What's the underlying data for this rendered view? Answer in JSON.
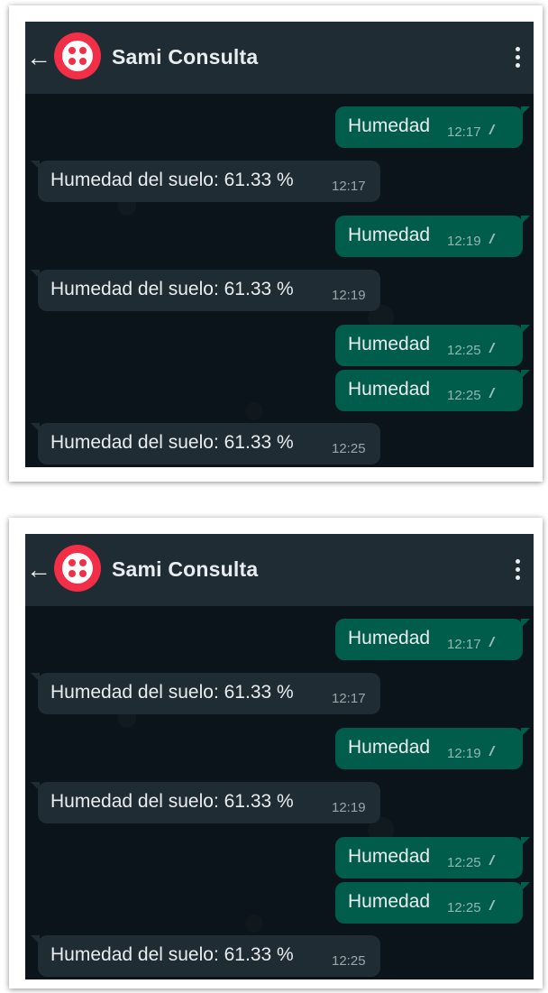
{
  "screenshots": [
    {
      "header": {
        "back_icon": "arrow-left-icon",
        "title": "Sami Consulta",
        "avatar_color": "#f22f46",
        "menu_icon": "kebab-icon"
      },
      "messages": [
        {
          "direction": "out",
          "text": "Humedad",
          "time": "12:17",
          "status": "read-ticks-icon"
        },
        {
          "direction": "in",
          "text": "Humedad del suelo: 61.33 %",
          "time": "12:17"
        },
        {
          "direction": "out",
          "text": "Humedad",
          "time": "12:19",
          "status": "read-ticks-icon"
        },
        {
          "direction": "in",
          "text": "Humedad del suelo: 61.33 %",
          "time": "12:19"
        },
        {
          "direction": "out",
          "text": "Humedad",
          "time": "12:25",
          "status": "read-ticks-icon"
        },
        {
          "direction": "out",
          "text": "Humedad",
          "time": "12:25",
          "status": "read-ticks-icon"
        },
        {
          "direction": "in",
          "text": "Humedad del suelo: 61.33 %",
          "time": "12:25"
        }
      ]
    },
    {
      "header": {
        "back_icon": "arrow-left-icon",
        "title": "Sami Consulta",
        "avatar_color": "#f22f46",
        "menu_icon": "kebab-icon"
      },
      "messages": [
        {
          "direction": "out",
          "text": "Humedad",
          "time": "12:17",
          "status": "read-ticks-icon"
        },
        {
          "direction": "in",
          "text": "Humedad del suelo: 61.33 %",
          "time": "12:17"
        },
        {
          "direction": "out",
          "text": "Humedad",
          "time": "12:19",
          "status": "read-ticks-icon"
        },
        {
          "direction": "in",
          "text": "Humedad del suelo: 61.33 %",
          "time": "12:19"
        },
        {
          "direction": "out",
          "text": "Humedad",
          "time": "12:25",
          "status": "read-ticks-icon"
        },
        {
          "direction": "out",
          "text": "Humedad",
          "time": "12:25",
          "status": "read-ticks-icon"
        },
        {
          "direction": "in",
          "text": "Humedad del suelo: 61.33 %",
          "time": "12:25"
        }
      ]
    }
  ],
  "colors": {
    "outgoing_bubble": "#005c4b",
    "incoming_bubble": "#1f2c34",
    "chat_background": "#0b141a",
    "header_background": "#1f2c34"
  }
}
